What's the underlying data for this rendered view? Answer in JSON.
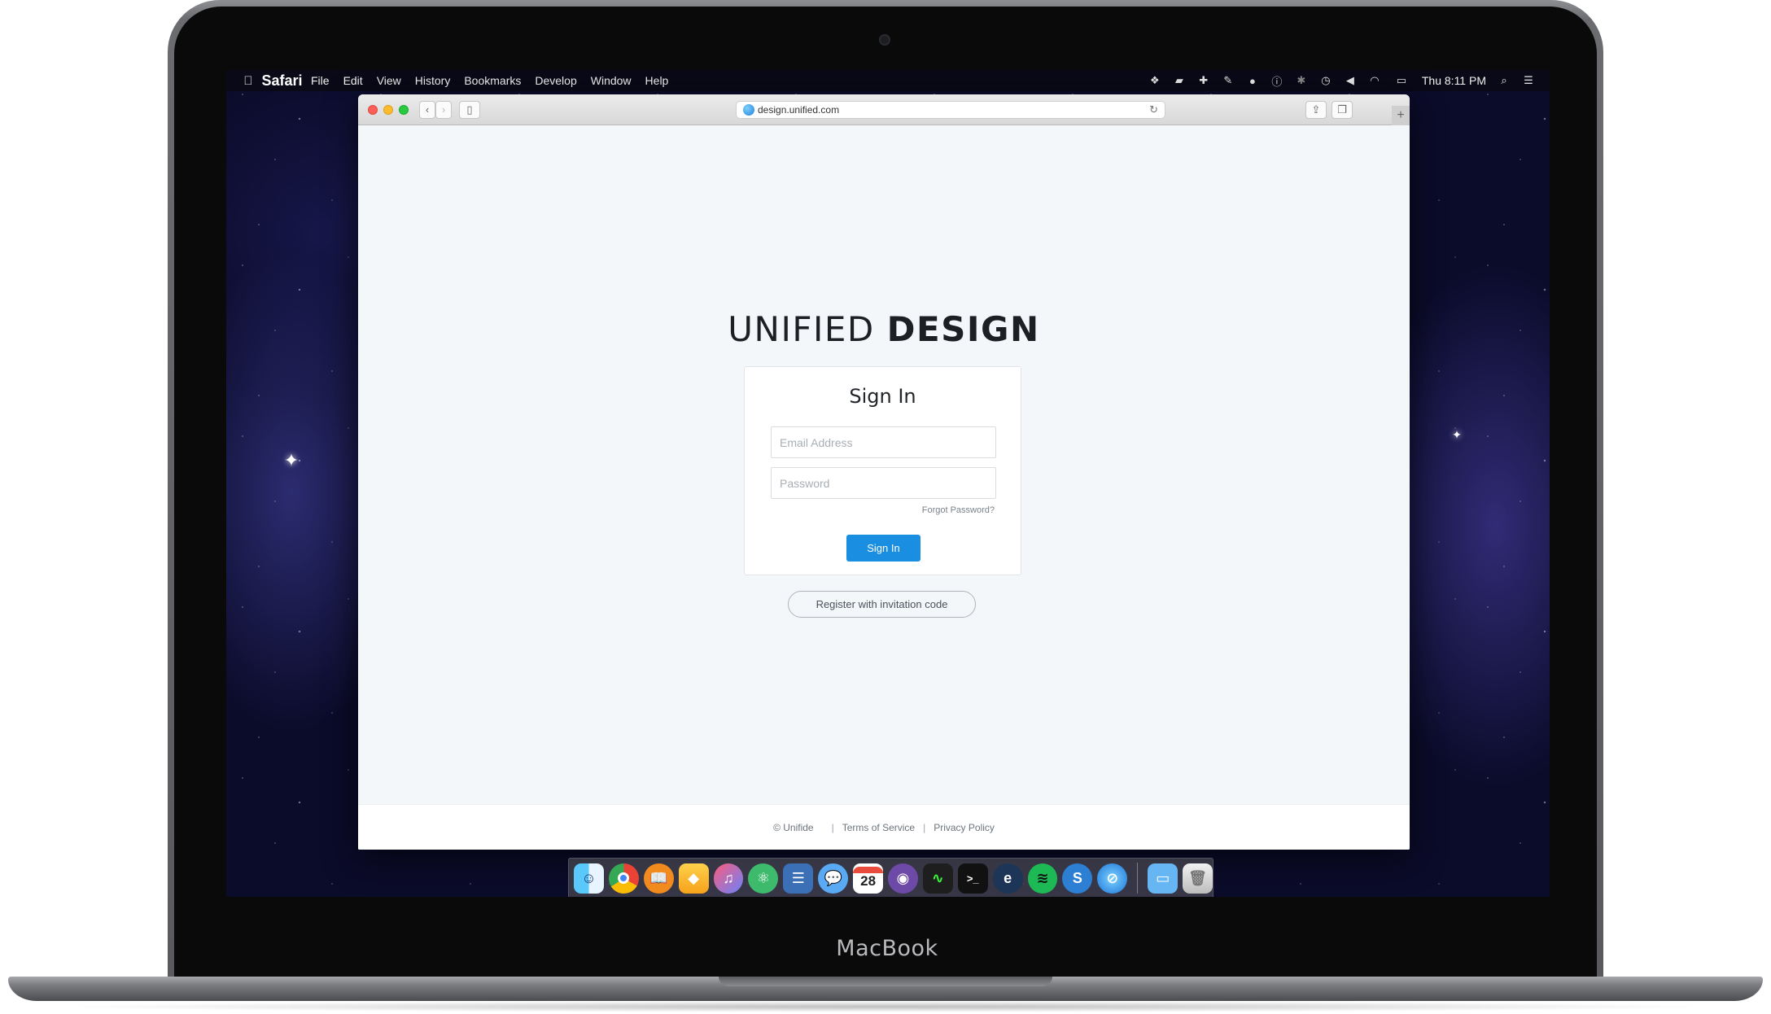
{
  "device": {
    "label": "MacBook"
  },
  "menubar": {
    "app_name": "Safari",
    "items": [
      "File",
      "Edit",
      "View",
      "History",
      "Bookmarks",
      "Develop",
      "Window",
      "Help"
    ],
    "clock": "Thu 8:11 PM"
  },
  "browser": {
    "url": "design.unified.com"
  },
  "page": {
    "brand_light": "UNIFIED ",
    "brand_bold": "DESIGN",
    "card_title": "Sign In",
    "email_placeholder": "Email Address",
    "password_placeholder": "Password",
    "forgot_link": "Forgot Password?",
    "signin_button": "Sign In",
    "register_button": "Register with invitation code",
    "footer": {
      "copyright": "© Unifide",
      "terms": "Terms of Service",
      "privacy": "Privacy Policy"
    }
  },
  "dock": {
    "calendar_day": "28"
  }
}
